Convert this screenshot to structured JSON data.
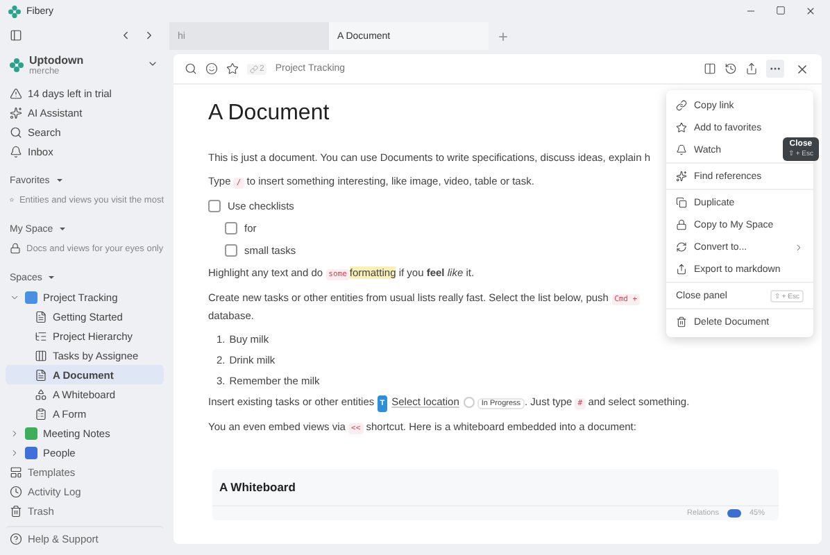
{
  "window": {
    "title": "Fibery"
  },
  "tabs": [
    {
      "label": "hi",
      "selected": false
    },
    {
      "label": "A Document",
      "selected": true
    }
  ],
  "sidebar": {
    "workspace": {
      "name": "Uptodown",
      "user": "merche"
    },
    "nav": [
      "14 days left in trial",
      "AI Assistant",
      "Search",
      "Inbox"
    ],
    "sections": [
      {
        "title": "Favorites",
        "hint": "Entities and views you visit the most"
      },
      {
        "title": "My Space",
        "hint": "Docs and views for your eyes only"
      }
    ],
    "spaces_title": "Spaces",
    "tree": [
      {
        "label": "Project Tracking",
        "color": "#4a90e2",
        "expanded": true,
        "selected": false,
        "children": [
          {
            "label": "Getting Started",
            "selected": false
          },
          {
            "label": "Project Hierarchy",
            "selected": false
          },
          {
            "label": "Tasks by Assignee",
            "selected": false
          },
          {
            "label": "A Document",
            "selected": true
          },
          {
            "label": "A Whiteboard",
            "selected": false
          },
          {
            "label": "A Form",
            "selected": false
          }
        ]
      },
      {
        "label": "Meeting Notes",
        "color": "#3fae5a",
        "expanded": false,
        "selected": false
      },
      {
        "label": "People",
        "color": "#3f6fd8",
        "expanded": false,
        "selected": false
      }
    ],
    "footer": [
      "Templates",
      "Activity Log",
      "Trash",
      "Help & Support"
    ]
  },
  "toolbar": {
    "link_count": "2",
    "breadcrumb": "Project Tracking"
  },
  "tooltip": {
    "title": "Close",
    "shortcut": "⇧ + Esc"
  },
  "menu": [
    [
      {
        "label": "Copy link"
      },
      {
        "label": "Add to favorites"
      },
      {
        "label": "Watch"
      }
    ],
    [
      {
        "label": "Find references"
      }
    ],
    [
      {
        "label": "Duplicate"
      },
      {
        "label": "Copy to My Space"
      },
      {
        "label": "Convert to...",
        "submenu": true
      },
      {
        "label": "Export to markdown"
      }
    ],
    [
      {
        "label": "Close panel",
        "shortcut": "⇧ + Esc"
      }
    ],
    [
      {
        "label": "Delete Document"
      }
    ]
  ],
  "document": {
    "title": "A Document",
    "blocks": [
      {
        "kind": "paragraph",
        "segments": [
          {
            "kind": "text",
            "text": "This is just a document. You can use Documents to write specifications, discuss ideas, explain h"
          }
        ]
      },
      {
        "kind": "paragraph",
        "segments": [
          {
            "kind": "text",
            "text": "Type "
          },
          {
            "kind": "code",
            "text": "/"
          },
          {
            "kind": "text",
            "text": " to insert something interesting, like image, video, table or task."
          }
        ]
      },
      {
        "kind": "check",
        "label": "Use checklists",
        "checked": false,
        "children": [
          {
            "label": "for",
            "checked": false
          },
          {
            "label": "small tasks",
            "checked": false
          }
        ]
      },
      {
        "kind": "paragraph",
        "segments": [
          {
            "kind": "text",
            "text": "Highlight any text and do "
          },
          {
            "kind": "code",
            "text": "some"
          },
          {
            "kind": "mark",
            "text": "formatting"
          },
          {
            "kind": "rich",
            "text": " if you **feel** *like* it."
          }
        ]
      },
      {
        "kind": "paragraph",
        "segments": [
          {
            "kind": "text",
            "text": "Create new tasks or other entities from usual lists really fast. Select the list below, push "
          },
          {
            "kind": "code",
            "text": "Cmd +"
          },
          {
            "kind": "line",
            "text": "database."
          }
        ]
      },
      {
        "kind": "numbered",
        "items": [
          {
            "number": "1.",
            "text": "Buy milk"
          },
          {
            "number": "2.",
            "text": "Drink milk"
          },
          {
            "number": "3.",
            "text": "Remember the milk"
          }
        ]
      },
      {
        "kind": "paragraph",
        "segments": [
          {
            "kind": "text",
            "text": "Insert existing tasks or other entities "
          },
          {
            "kind": "entity",
            "text": "T"
          },
          {
            "kind": "location",
            "text": "Select location"
          },
          {
            "kind": "radio"
          },
          {
            "kind": "status",
            "text": "In Progress"
          },
          {
            "kind": "text",
            "text": ". Just type "
          },
          {
            "kind": "code",
            "text": "#"
          },
          {
            "kind": "text",
            "text": " and select something."
          }
        ]
      },
      {
        "kind": "paragraph",
        "segments": [
          {
            "kind": "text",
            "text": "You an even embed views via "
          },
          {
            "kind": "code",
            "text": "<<"
          },
          {
            "kind": "text",
            "text": " shortcut. Here is a whiteboard embedded into a document:"
          }
        ]
      }
    ],
    "embed": {
      "title": "A Whiteboard",
      "relations_label": "Relations",
      "relations_on": true,
      "zoom": "45%"
    }
  }
}
